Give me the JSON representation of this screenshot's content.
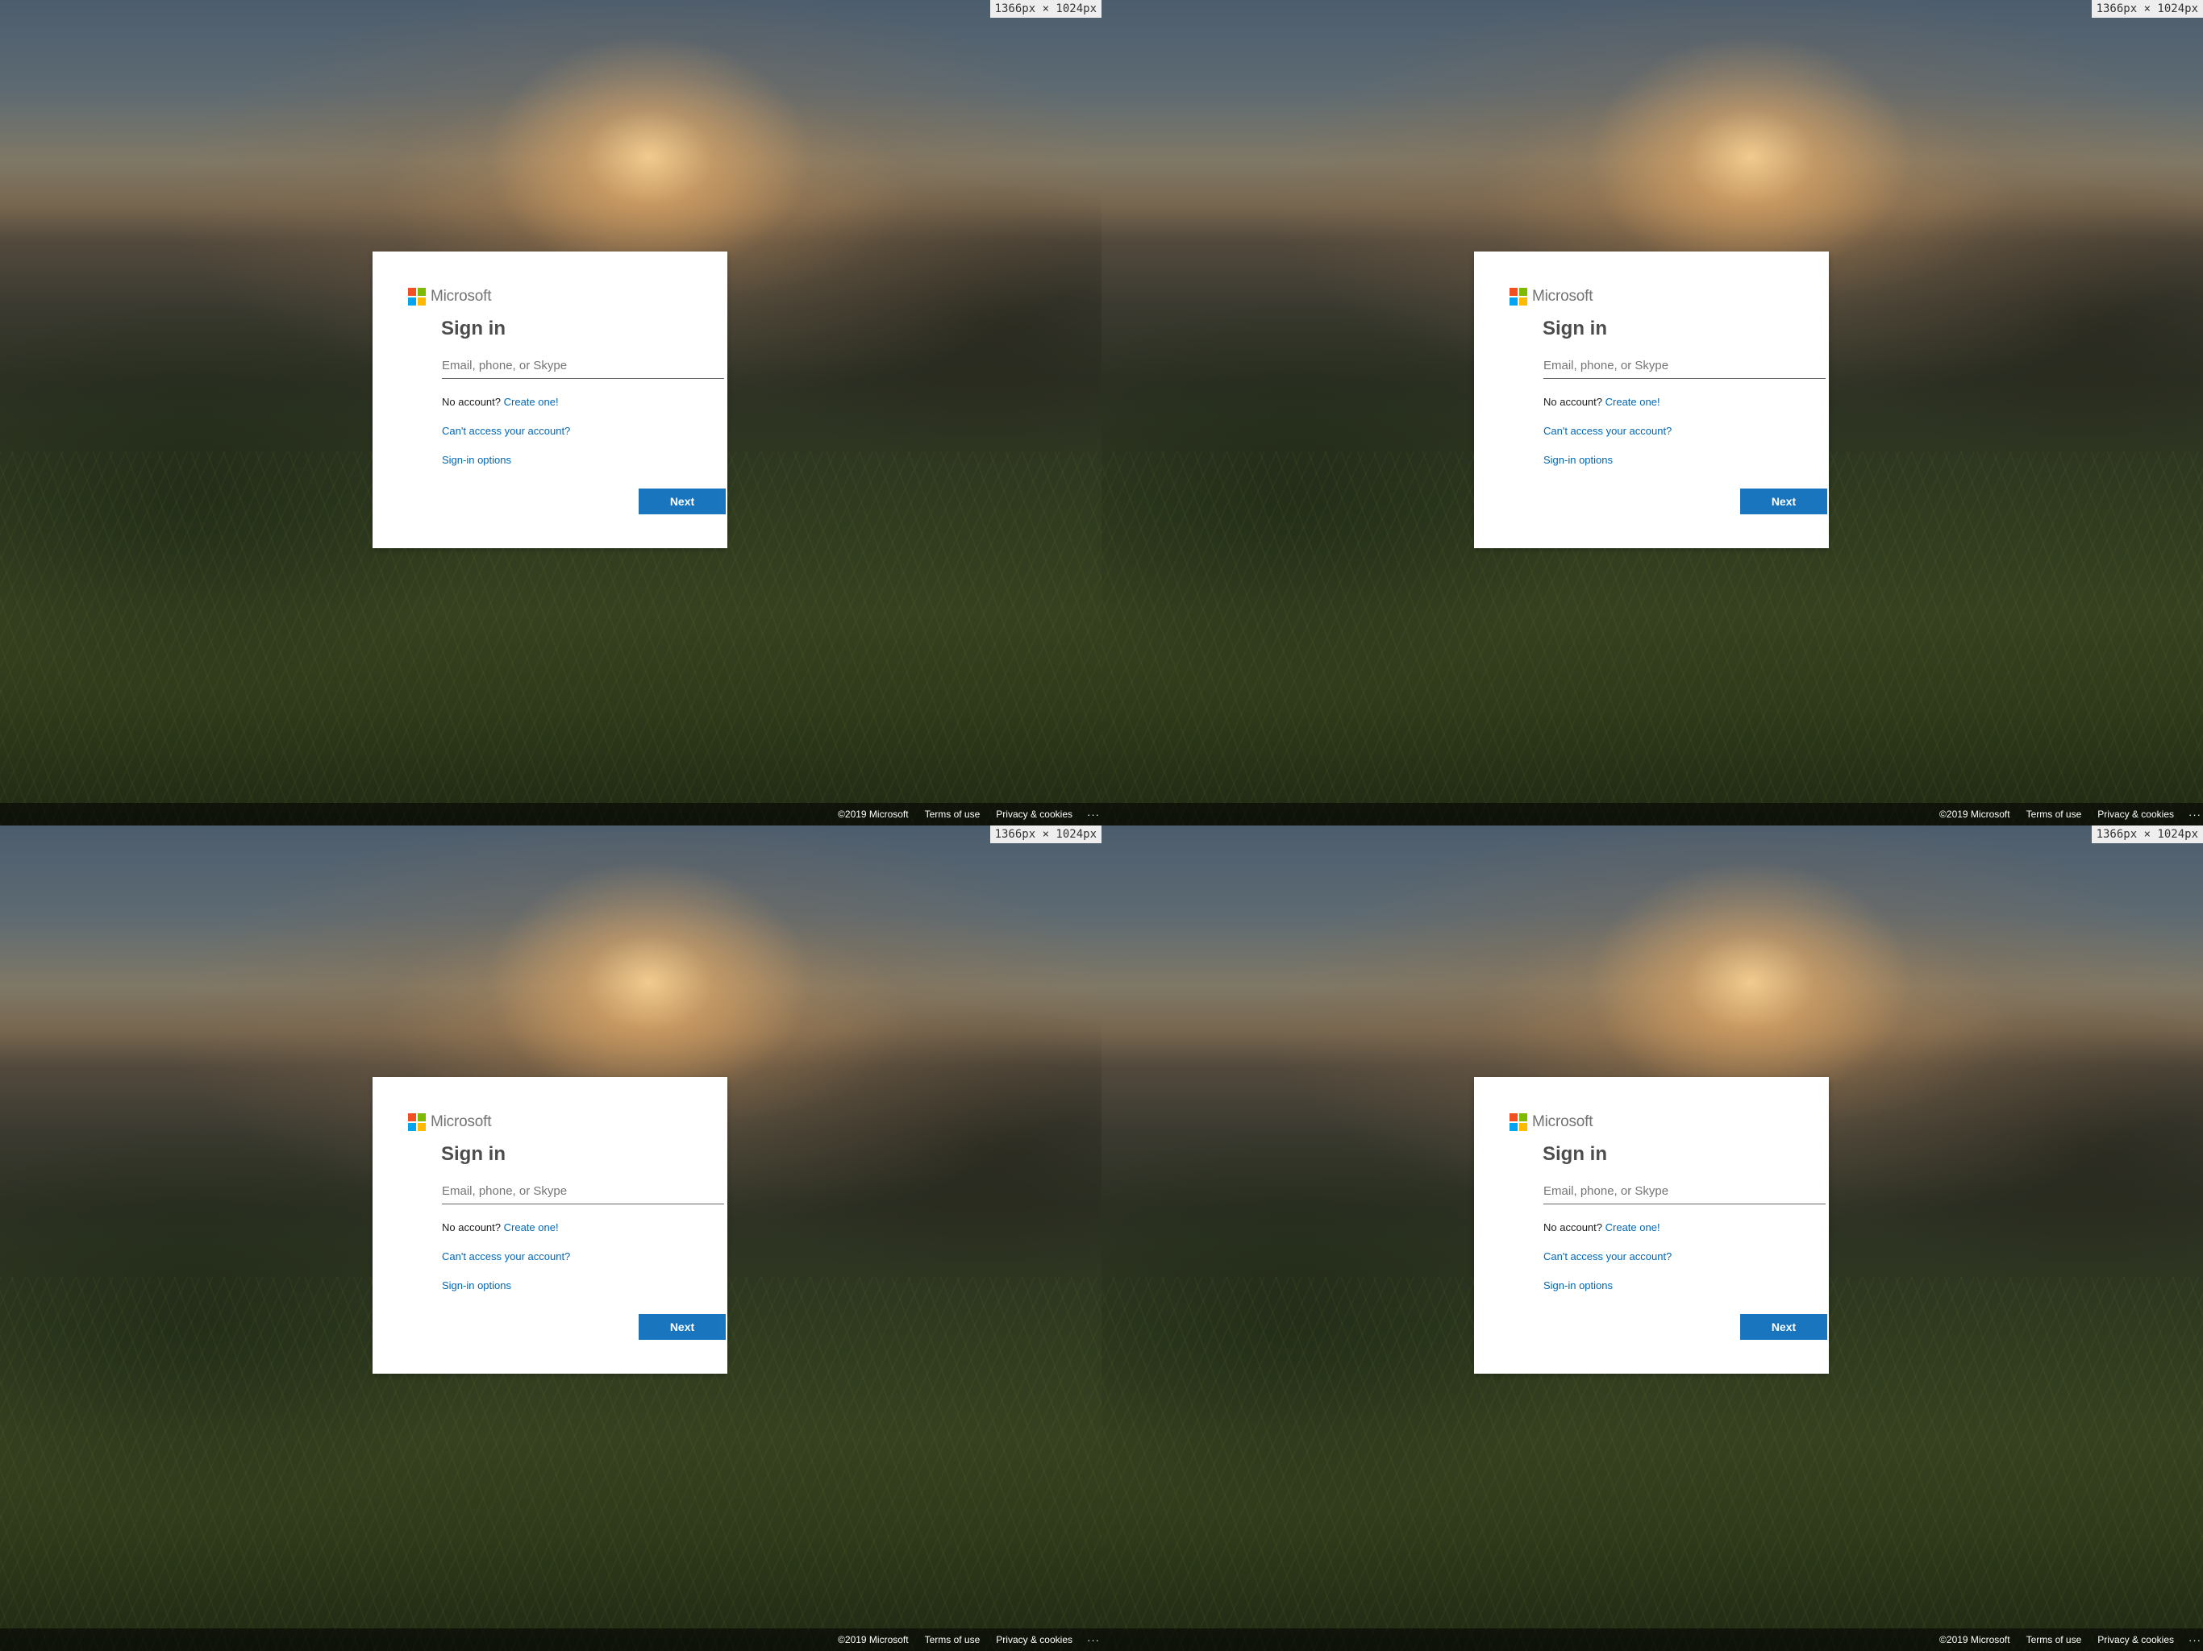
{
  "panels": [
    {
      "dimension_label": "1366px × 1024px",
      "logo_text": "Microsoft",
      "title": "Sign in",
      "email_placeholder": "Email, phone, or Skype",
      "no_account_text": "No account?",
      "create_link": "Create one!",
      "cant_access_link": "Can't access your account?",
      "signin_options_link": "Sign-in options",
      "next_label": "Next",
      "footer": {
        "copyright": "©2019 Microsoft",
        "terms": "Terms of use",
        "privacy": "Privacy & cookies",
        "more": "···"
      }
    },
    {
      "dimension_label": "1366px × 1024px",
      "logo_text": "Microsoft",
      "title": "Sign in",
      "email_placeholder": "Email, phone, or Skype",
      "no_account_text": "No account?",
      "create_link": "Create one!",
      "cant_access_link": "Can't access your account?",
      "signin_options_link": "Sign-in options",
      "next_label": "Next",
      "footer": {
        "copyright": "©2019 Microsoft",
        "terms": "Terms of use",
        "privacy": "Privacy & cookies",
        "more": "···"
      }
    },
    {
      "dimension_label": "1366px × 1024px",
      "logo_text": "Microsoft",
      "title": "Sign in",
      "email_placeholder": "Email, phone, or Skype",
      "no_account_text": "No account?",
      "create_link": "Create one!",
      "cant_access_link": "Can't access your account?",
      "signin_options_link": "Sign-in options",
      "next_label": "Next",
      "footer": {
        "copyright": "©2019 Microsoft",
        "terms": "Terms of use",
        "privacy": "Privacy & cookies",
        "more": "···"
      }
    },
    {
      "dimension_label": "1366px × 1024px",
      "logo_text": "Microsoft",
      "title": "Sign in",
      "email_placeholder": "Email, phone, or Skype",
      "no_account_text": "No account?",
      "create_link": "Create one!",
      "cant_access_link": "Can't access your account?",
      "signin_options_link": "Sign-in options",
      "next_label": "Next",
      "footer": {
        "copyright": "©2019 Microsoft",
        "terms": "Terms of use",
        "privacy": "Privacy & cookies",
        "more": "···"
      }
    }
  ],
  "colors": {
    "accent": "#0067b8",
    "logo_red": "#f25022",
    "logo_green": "#7fba00",
    "logo_blue": "#00a4ef",
    "logo_yellow": "#ffb900",
    "icons": [
      "microsoft-logo-icon",
      "more-icon"
    ]
  }
}
